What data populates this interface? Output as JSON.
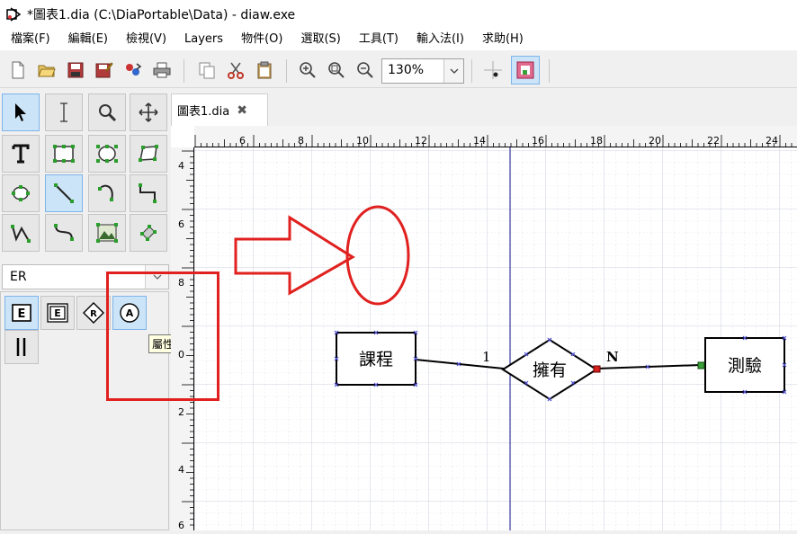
{
  "window": {
    "title": "*圖表1.dia (C:\\DiaPortable\\Data) - diaw.exe"
  },
  "menu": [
    "檔案(F)",
    "編輯(E)",
    "檢視(V)",
    "Layers",
    "物件(O)",
    "選取(S)",
    "工具(T)",
    "輸入法(I)",
    "求助(H)"
  ],
  "toolbar": {
    "zoom": "130%"
  },
  "sheet": {
    "selected": "ER",
    "tooltip": "屬性"
  },
  "tab": {
    "label": "圖表1.dia"
  },
  "ruler": {
    "top_ticks": [
      "6",
      "8",
      "10",
      "12",
      "14",
      "16",
      "18",
      "20",
      "22",
      "24"
    ],
    "left_ticks": [
      "4",
      "6",
      "8",
      "0",
      "2",
      "4",
      "6"
    ]
  },
  "diagram": {
    "entity_left": "課程",
    "relationship": "擁有",
    "entity_right": "測驗",
    "card_left": "1",
    "card_right": "N"
  },
  "colors": {
    "annotation": "#e0211f",
    "guide": "#3c3c9c",
    "handle": "#5050d0"
  }
}
